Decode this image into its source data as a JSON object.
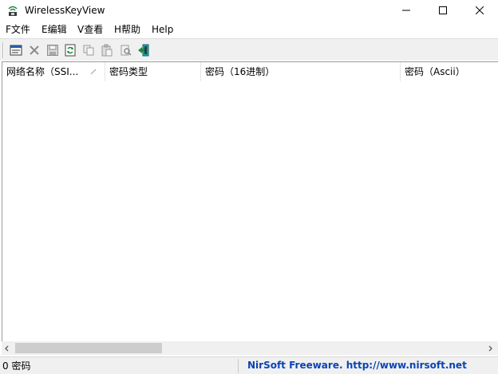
{
  "window": {
    "title": "WirelessKeyView",
    "icons": {
      "app": "wifi-key-icon",
      "minimize": "minimize-icon",
      "maximize": "maximize-icon",
      "close": "close-icon"
    }
  },
  "menu": {
    "items": [
      {
        "label": "F文件"
      },
      {
        "label": "E编辑"
      },
      {
        "label": "V查看"
      },
      {
        "label": "H帮助"
      },
      {
        "label": "Help"
      }
    ]
  },
  "toolbar": {
    "buttons": [
      {
        "icon": "properties-icon",
        "enabled": true
      },
      {
        "icon": "delete-icon",
        "enabled": false
      },
      {
        "icon": "save-icon",
        "enabled": false
      },
      {
        "icon": "refresh-icon",
        "enabled": true
      },
      {
        "icon": "copy-icon",
        "enabled": false
      },
      {
        "icon": "paste-icon",
        "enabled": false
      },
      {
        "icon": "export-icon",
        "enabled": false
      },
      {
        "icon": "exit-icon",
        "enabled": true
      }
    ]
  },
  "list": {
    "columns": [
      {
        "label": "网络名称（SSI..."
      },
      {
        "label": "密码类型"
      },
      {
        "label": "密码（16进制）"
      },
      {
        "label": "密码（Ascii）"
      }
    ],
    "sort_icon": "sort-descending-icon",
    "rows": []
  },
  "scrollbar": {
    "left_icon": "chevron-left-icon",
    "right_icon": "chevron-right-icon"
  },
  "status": {
    "count": "0 密码",
    "link": "NirSoft Freeware.  http://www.nirsoft.net"
  },
  "colors": {
    "link": "#0b44b4",
    "chrome": "#f0f0f0",
    "accent_green": "#1f8a3a",
    "accent_teal": "#12a5b0"
  }
}
